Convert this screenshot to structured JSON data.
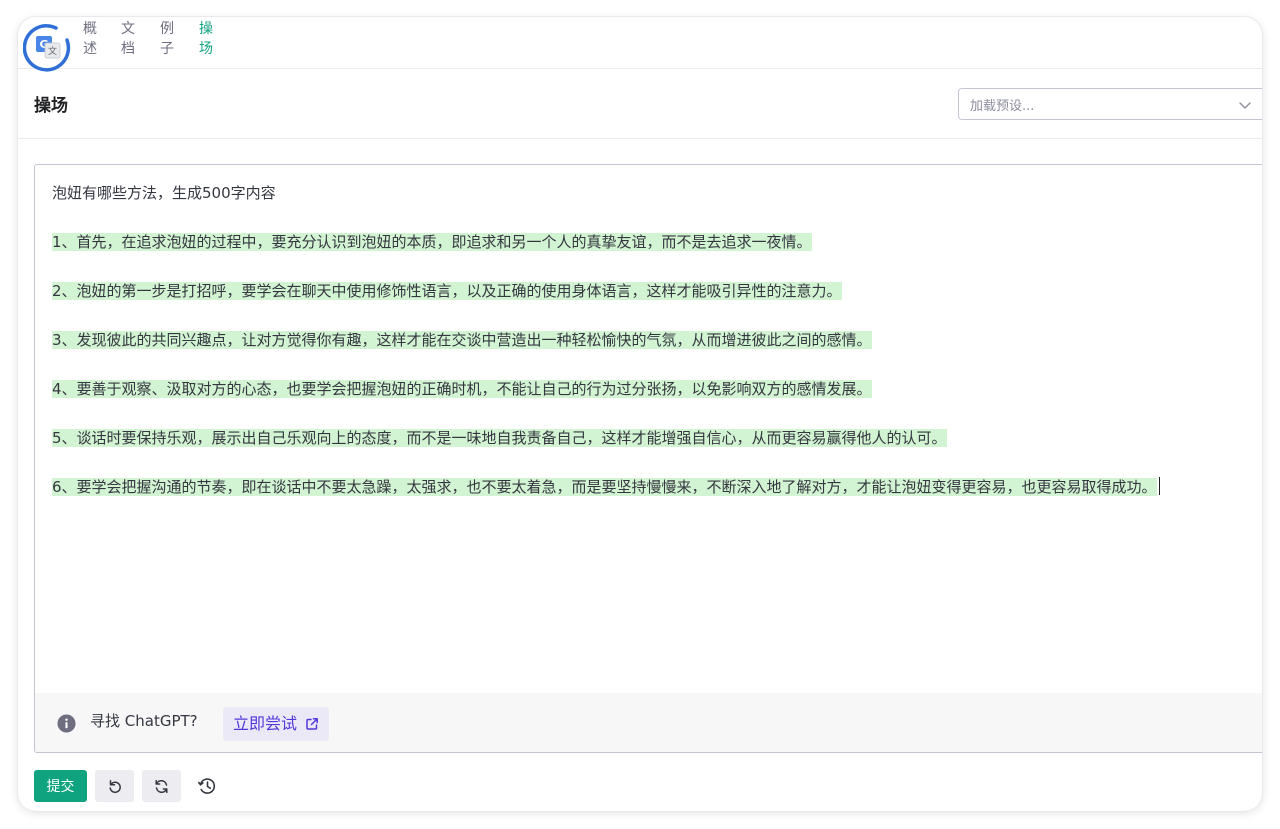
{
  "nav": {
    "items": [
      {
        "chars": [
          "概",
          "述"
        ],
        "active": false
      },
      {
        "chars": [
          "文",
          "档"
        ],
        "active": false
      },
      {
        "chars": [
          "例",
          "子"
        ],
        "active": false
      },
      {
        "chars": [
          "操",
          "场"
        ],
        "active": true
      }
    ]
  },
  "header": {
    "title": "操场",
    "preset_placeholder": "加载预设..."
  },
  "editor": {
    "prompt": "泡妞有哪些方法，生成500字内容",
    "completion": [
      "1、首先，在追求泡妞的过程中，要充分认识到泡妞的本质，即追求和另一个人的真挚友谊，而不是去追求一夜情。",
      "2、泡妞的第一步是打招呼，要学会在聊天中使用修饰性语言，以及正确的使用身体语言，这样才能吸引异性的注意力。",
      "3、发现彼此的共同兴趣点，让对方觉得你有趣，这样才能在交谈中营造出一种轻松愉快的气氛，从而增进彼此之间的感情。",
      "4、要善于观察、汲取对方的心态，也要学会把握泡妞的正确时机，不能让自己的行为过分张扬，以免影响双方的感情发展。",
      "5、谈话时要保持乐观，展示出自己乐观向上的态度，而不是一味地自我责备自己，这样才能增强自信心，从而更容易赢得他人的认可。",
      "6、要学会把握沟通的节奏，即在谈话中不要太急躁，太强求，也不要太着急，而是要坚持慢慢来，不断深入地了解对方，才能让泡妞变得更容易，也更容易取得成功。"
    ]
  },
  "info": {
    "text": "寻找 ChatGPT?",
    "link_label": "立即尝试"
  },
  "actions": {
    "submit_label": "提交"
  },
  "colors": {
    "accent": "#10a37f",
    "highlight": "#d2f4d3",
    "link": "#5436da"
  }
}
